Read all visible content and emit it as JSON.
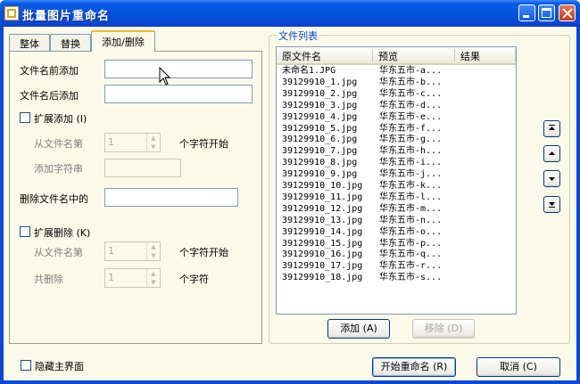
{
  "window": {
    "title": "批量图片重命名"
  },
  "tabs": [
    {
      "label": "整体"
    },
    {
      "label": "替换"
    },
    {
      "label": "添加/删除"
    }
  ],
  "add_panel": {
    "prefix_label": "文件名前添加",
    "suffix_label": "文件名后添加",
    "ext_add_label": "扩展添加 (I)",
    "from_pos_label": "从文件名第",
    "from_pos_value": "1",
    "char_start_label": "个字符开始",
    "add_string_label": "添加字符串",
    "delete_in_name_label": "删除文件名中的",
    "ext_delete_label": "扩展删除 (K)",
    "del_from_pos_label": "从文件名第",
    "del_from_pos_value": "1",
    "del_char_start_label": "个字符开始",
    "total_delete_label": "共删除",
    "total_delete_value": "1",
    "chars_label": "个字符"
  },
  "file_list": {
    "group_label": "文件列表",
    "columns": [
      "原文件名",
      "预览",
      "结果"
    ],
    "rows": [
      {
        "original": "未命名1.JPG",
        "preview": "华东五市-a..."
      },
      {
        "original": "39129910_1.jpg",
        "preview": "华东五市-b..."
      },
      {
        "original": "39129910_2.jpg",
        "preview": "华东五市-c..."
      },
      {
        "original": "39129910_3.jpg",
        "preview": "华东五市-d..."
      },
      {
        "original": "39129910_4.jpg",
        "preview": "华东五市-e..."
      },
      {
        "original": "39129910_5.jpg",
        "preview": "华东五市-f..."
      },
      {
        "original": "39129910_6.jpg",
        "preview": "华东五市-g..."
      },
      {
        "original": "39129910_7.jpg",
        "preview": "华东五市-h..."
      },
      {
        "original": "39129910_8.jpg",
        "preview": "华东五市-i..."
      },
      {
        "original": "39129910_9.jpg",
        "preview": "华东五市-j..."
      },
      {
        "original": "39129910_10.jpg",
        "preview": "华东五市-k..."
      },
      {
        "original": "39129910_11.jpg",
        "preview": "华东五市-l..."
      },
      {
        "original": "39129910_12.jpg",
        "preview": "华东五市-m..."
      },
      {
        "original": "39129910_13.jpg",
        "preview": "华东五市-n..."
      },
      {
        "original": "39129910_14.jpg",
        "preview": "华东五市-o..."
      },
      {
        "original": "39129910_15.jpg",
        "preview": "华东五市-p..."
      },
      {
        "original": "39129910_16.jpg",
        "preview": "华东五市-q..."
      },
      {
        "original": "39129910_17.jpg",
        "preview": "华东五市-r..."
      },
      {
        "original": "39129910_18.jpg",
        "preview": "华东五市-s..."
      }
    ],
    "add_button": "添加 (A)",
    "remove_button": "移除 (D)"
  },
  "move_buttons": {
    "top": "move-top-icon",
    "up": "move-up-icon",
    "down": "move-down-icon",
    "bottom": "move-bottom-icon"
  },
  "footer": {
    "hide_main_label": "隐藏主界面",
    "start_button": "开始重命名 (R)",
    "cancel_button": "取消 (C)"
  }
}
